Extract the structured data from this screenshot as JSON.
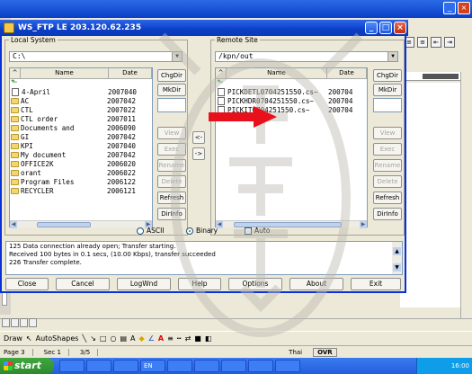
{
  "ftp": {
    "title": "WS_FTP LE 203.120.62.235",
    "local": {
      "group_label": "Local System",
      "path": "C:\\",
      "col_name": "Name",
      "col_date": "Date",
      "rows": [
        {
          "type": "up",
          "name": "",
          "date": ""
        },
        {
          "type": "file",
          "name": "4-April",
          "date": "2007040"
        },
        {
          "type": "folder",
          "name": "AC",
          "date": "2007042"
        },
        {
          "type": "folder",
          "name": "CTL",
          "date": "2007022"
        },
        {
          "type": "folder",
          "name": "CTL order",
          "date": "2007011"
        },
        {
          "type": "folder",
          "name": "Documents and",
          "date": "2006090"
        },
        {
          "type": "folder",
          "name": "GI",
          "date": "2007042"
        },
        {
          "type": "folder",
          "name": "KPI",
          "date": "2007040"
        },
        {
          "type": "folder",
          "name": "My document",
          "date": "2007042"
        },
        {
          "type": "folder",
          "name": "OFFICE2K",
          "date": "2006020"
        },
        {
          "type": "folder",
          "name": "orant",
          "date": "2006022"
        },
        {
          "type": "folder",
          "name": "Program Files",
          "date": "2006122"
        },
        {
          "type": "folder",
          "name": "RECYCLER",
          "date": "2006121"
        }
      ],
      "buttons": {
        "chgdir": "ChgDir",
        "mkdir": "MkDir",
        "view": "View",
        "exec": "Exec",
        "rename": "Rename",
        "delete": "Delete",
        "refresh": "Refresh",
        "dirinfo": "DirInfo"
      }
    },
    "remote": {
      "group_label": "Remote Site",
      "path": "/kpn/out",
      "col_name": "Name",
      "col_date": "Date",
      "rows": [
        {
          "type": "up",
          "name": "",
          "date": ""
        },
        {
          "type": "file",
          "name": "PICKDETL0704251550.cs~",
          "date": "200704"
        },
        {
          "type": "file",
          "name": "PICKHDR0704251550.cs~",
          "date": "200704"
        },
        {
          "type": "file",
          "name": "PICKIT0704251550.cs~",
          "date": "200704"
        }
      ],
      "buttons": {
        "chgdir": "ChgDir",
        "mkdir": "MkDir",
        "view": "View",
        "exec": "Exec",
        "rename": "Rename",
        "delete": "Delete",
        "refresh": "Refresh",
        "dirinfo": "DirInfo"
      }
    },
    "transfer": {
      "left": "<-",
      "right": "->"
    },
    "mode": {
      "ascii": "ASCII",
      "binary": "Binary",
      "auto": "Auto",
      "selected": "binary"
    },
    "log_lines": [
      "125 Data connection already open; Transfer starting.",
      "Received 100 bytes in 0.1 secs, (10.00 Kbps), transfer succeeded",
      "226 Transfer complete."
    ],
    "bottom_buttons": {
      "close": "Close",
      "cancel": "Cancel",
      "logwnd": "LogWnd",
      "help": "Help",
      "options": "Options",
      "about": "About",
      "exit": "Exit"
    }
  },
  "word": {
    "drawbar": {
      "draw": "Draw",
      "autoshapes": "AutoShapes"
    },
    "status": {
      "page": "Page 3",
      "sec": "Sec 1",
      "pos": "3/5",
      "lang": "Thai",
      "ovr": "OVR"
    }
  },
  "taskbar": {
    "start": "start",
    "tasks": [
      "",
      "",
      "",
      "EN",
      "",
      "",
      "",
      "",
      ""
    ],
    "clock": "16:00"
  },
  "colors": {
    "title_blue": "#0a3fc7",
    "arrow_red": "#e8101a",
    "start_green": "#2d8a2d"
  }
}
